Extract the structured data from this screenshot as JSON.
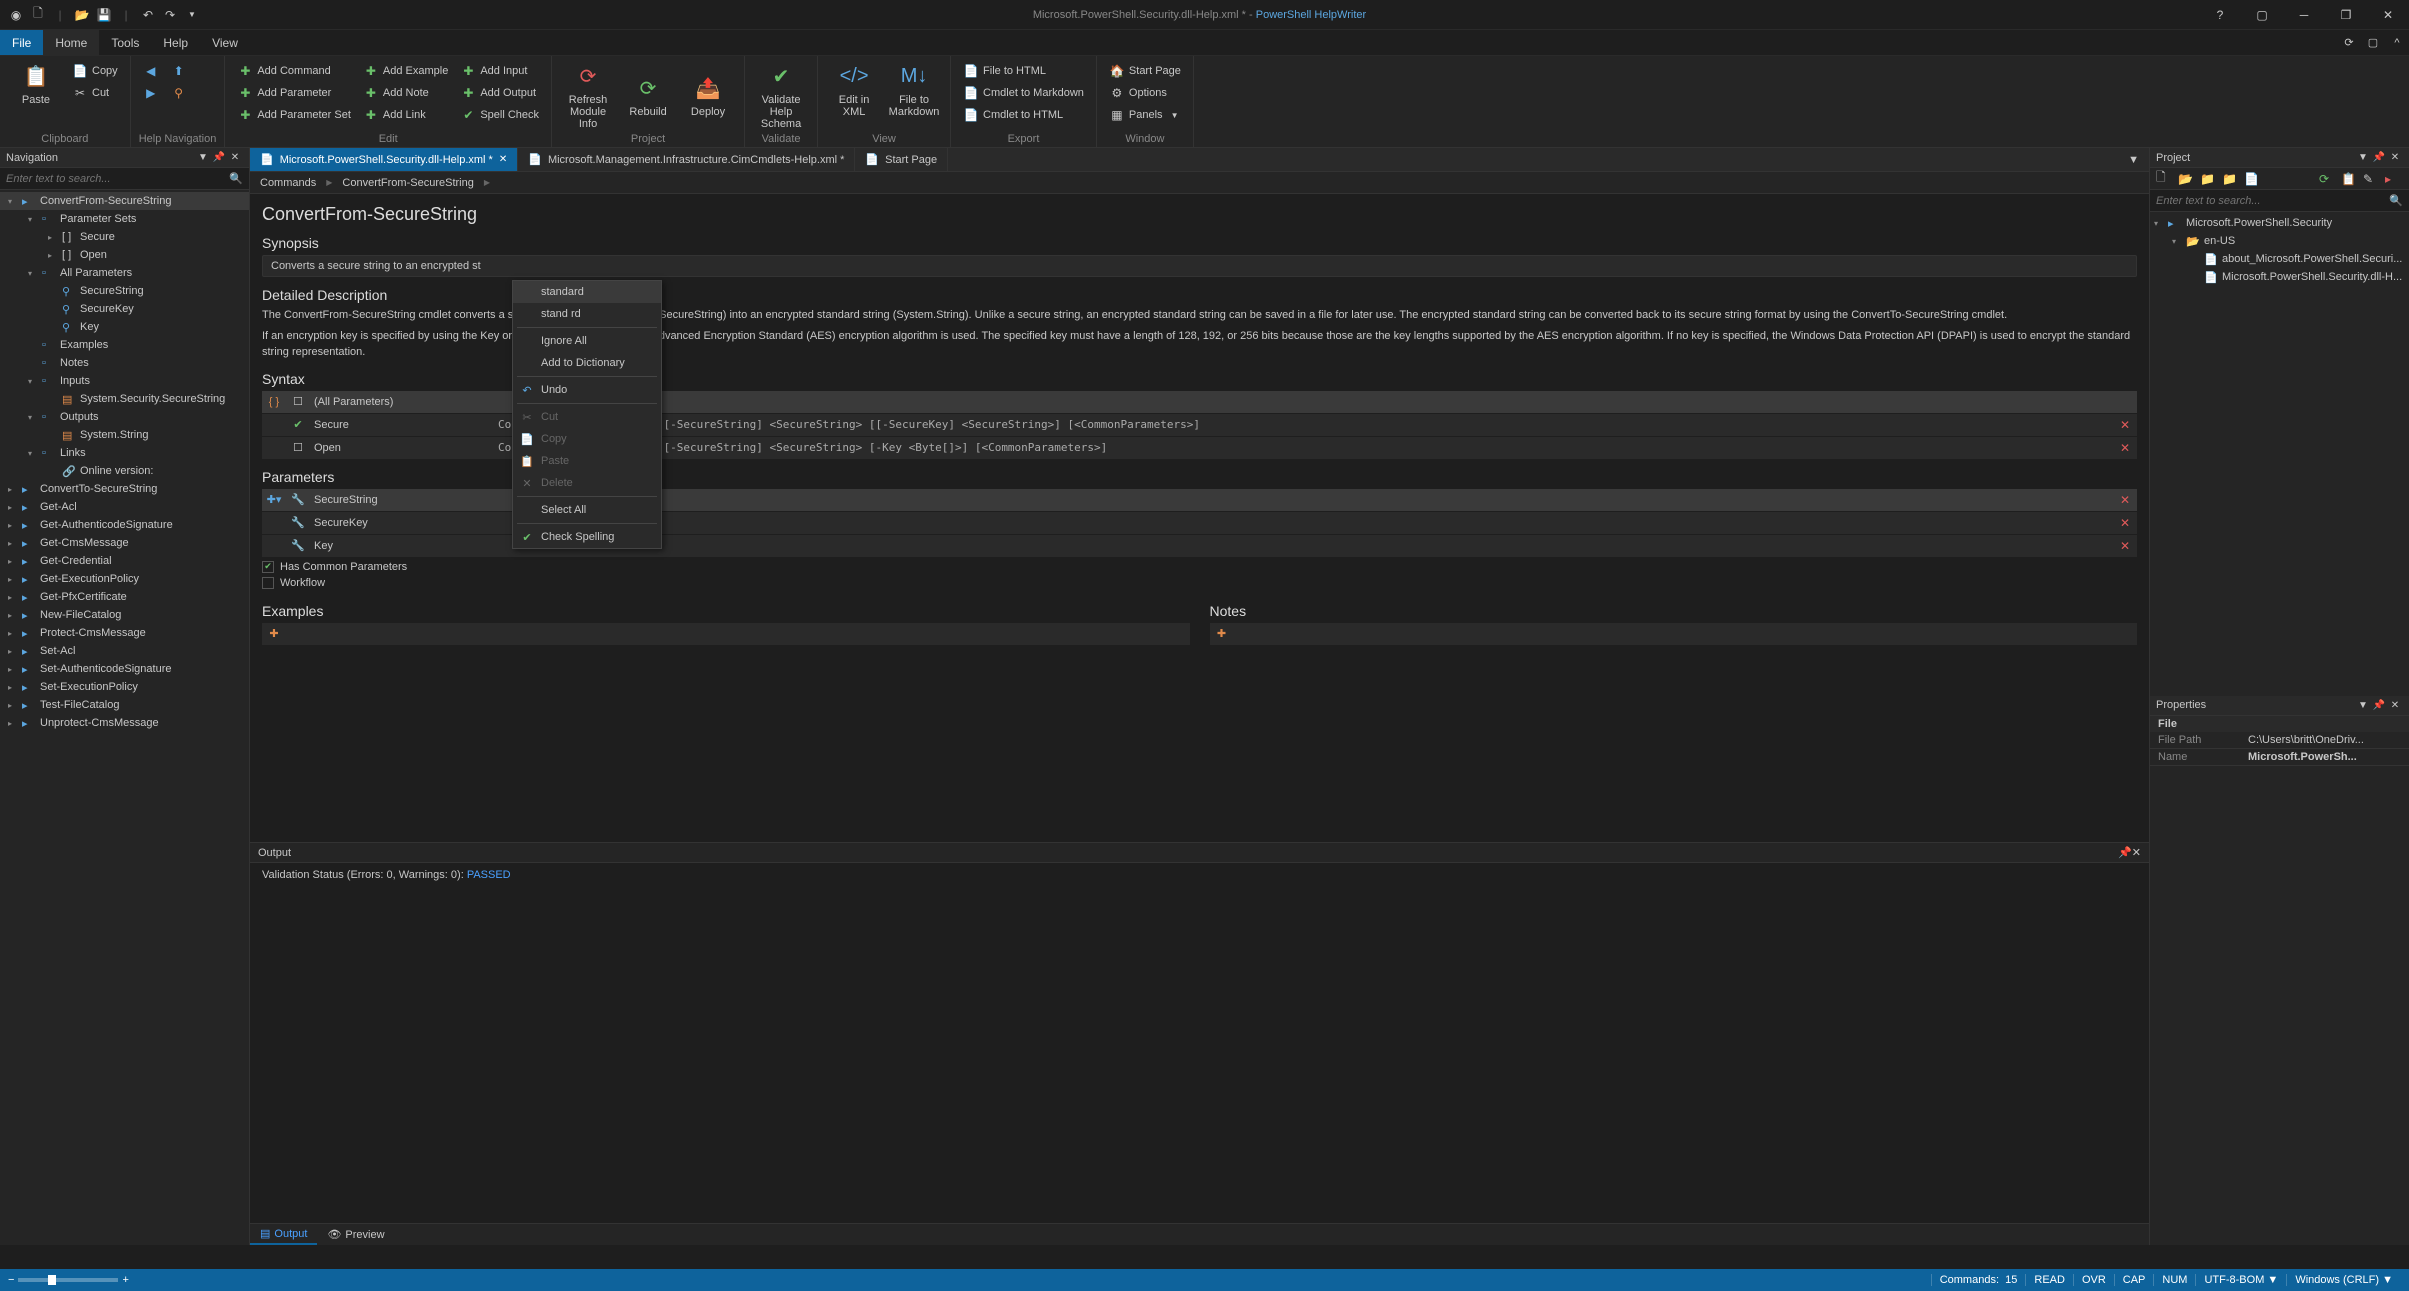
{
  "titlebar": {
    "doc_title": "Microsoft.PowerShell.Security.dll-Help.xml *",
    "app_name": "PowerShell HelpWriter"
  },
  "menutabs": {
    "file": "File",
    "home": "Home",
    "tools": "Tools",
    "help": "Help",
    "view": "View"
  },
  "ribbon": {
    "clipboard": {
      "label": "Clipboard",
      "paste": "Paste",
      "copy": "Copy",
      "cut": "Cut"
    },
    "help_nav": {
      "label": "Help Navigation"
    },
    "edit": {
      "label": "Edit",
      "add_command": "Add Command",
      "add_parameter": "Add Parameter",
      "add_parameter_set": "Add Parameter Set",
      "add_example": "Add Example",
      "add_note": "Add Note",
      "add_link": "Add Link",
      "add_input": "Add Input",
      "add_output": "Add Output",
      "spell_check": "Spell Check"
    },
    "project": {
      "label": "Project",
      "refresh": "Refresh\nModule Info",
      "rebuild": "Rebuild",
      "deploy": "Deploy"
    },
    "validate": {
      "label": "Validate",
      "validate": "Validate\nHelp Schema"
    },
    "view": {
      "label": "View",
      "edit_in_xml": "Edit in XML",
      "file_to_md": "File to\nMarkdown"
    },
    "export": {
      "label": "Export",
      "file_to_html": "File to HTML",
      "cmdlet_to_md": "Cmdlet to Markdown",
      "cmdlet_to_html": "Cmdlet to HTML"
    },
    "window": {
      "label": "Window",
      "start_page": "Start Page",
      "options": "Options",
      "panels": "Panels"
    }
  },
  "doctabs": {
    "t1": "Microsoft.PowerShell.Security.dll-Help.xml *",
    "t2": "Microsoft.Management.Infrastructure.CimCmdlets-Help.xml *",
    "t3": "Start Page"
  },
  "nav": {
    "title": "Navigation",
    "search_ph": "Enter text to search...",
    "items": {
      "root": "ConvertFrom-SecureString",
      "param_sets": "Parameter Sets",
      "secure": "Secure",
      "open": "Open",
      "all_params": "All Parameters",
      "securestring": "SecureString",
      "securekey": "SecureKey",
      "key": "Key",
      "examples": "Examples",
      "notes": "Notes",
      "inputs": "Inputs",
      "input1": "System.Security.SecureString",
      "outputs": "Outputs",
      "output1": "System.String",
      "links": "Links",
      "online": "Online version:",
      "convertto": "ConvertTo-SecureString",
      "getacl": "Get-Acl",
      "getauth": "Get-AuthenticodeSignature",
      "getcms": "Get-CmsMessage",
      "getcred": "Get-Credential",
      "getexec": "Get-ExecutionPolicy",
      "getpfx": "Get-PfxCertificate",
      "newfile": "New-FileCatalog",
      "protect": "Protect-CmsMessage",
      "setacl": "Set-Acl",
      "setauth": "Set-AuthenticodeSignature",
      "setexec": "Set-ExecutionPolicy",
      "testfile": "Test-FileCatalog",
      "unprotect": "Unprotect-CmsMessage"
    }
  },
  "breadcrumb": {
    "a": "Commands",
    "b": "ConvertFrom-SecureString"
  },
  "editor": {
    "title": "ConvertFrom-SecureString",
    "synopsis_h": "Synopsis",
    "synopsis": "Converts a secure string to an encrypted st",
    "detail_h": "Detailed Description",
    "detail1": "The ConvertFrom-SecureString cmdlet converts a secure string (System.Security.SecureString) into an encrypted standard string (System.String). Unlike a secure string, an encrypted standard string can be saved in a file for later use. The encrypted standard string can be converted back to its secure string format by using the ConvertTo-SecureString cmdlet.",
    "detail2": "If an encryption key is specified by using the Key or SecureKey parameters, the Advanced Encryption Standard (AES) encryption algorithm is used. The specified key must have a length of 128, 192, or 256 bits because those are the key lengths supported by the AES encryption algorithm. If no key is specified, the Windows Data Protection API (DPAPI) is used to encrypt the standard string representation.",
    "syntax_h": "Syntax",
    "all_params": "(All Parameters)",
    "secure": "Secure",
    "secure_cmd": "ConvertFrom-SecureString [-SecureString] <SecureString> [[-SecureKey] <SecureString>] [<CommonParameters>]",
    "open": "Open",
    "open_cmd": "ConvertFrom-SecureString [-SecureString] <SecureString> [-Key <Byte[]>] [<CommonParameters>]",
    "params_h": "Parameters",
    "p1": "SecureString",
    "p2": "SecureKey",
    "p3": "Key",
    "has_common": "Has Common Parameters",
    "workflow": "Workflow",
    "examples_h": "Examples",
    "notes_h": "Notes"
  },
  "ctxmenu": {
    "standard": "standard",
    "standrd": "stand rd",
    "ignore": "Ignore All",
    "adddict": "Add to Dictionary",
    "undo": "Undo",
    "cut": "Cut",
    "copy": "Copy",
    "paste": "Paste",
    "delete": "Delete",
    "selectall": "Select All",
    "spell": "Check Spelling"
  },
  "output": {
    "title": "Output",
    "line": "Validation Status (Errors: 0, Warnings: 0): ",
    "passed": "PASSED",
    "tab_output": "Output",
    "tab_preview": "Preview"
  },
  "project": {
    "title": "Project",
    "search_ph": "Enter text to search...",
    "root": "Microsoft.PowerShell.Security",
    "folder": "en-US",
    "f1": "about_Microsoft.PowerShell.Securi...",
    "f2": "Microsoft.PowerShell.Security.dll-H..."
  },
  "properties": {
    "title": "Properties",
    "group": "File",
    "filepath_k": "File Path",
    "filepath_v": "C:\\Users\\britt\\OneDriv...",
    "name_k": "Name",
    "name_v": "Microsoft.PowerSh..."
  },
  "status": {
    "commands": "Commands:",
    "commands_n": "15",
    "read": "READ",
    "ovr": "OVR",
    "cap": "CAP",
    "num": "NUM",
    "encoding": "UTF-8-BOM",
    "eol": "Windows (CRLF)"
  }
}
